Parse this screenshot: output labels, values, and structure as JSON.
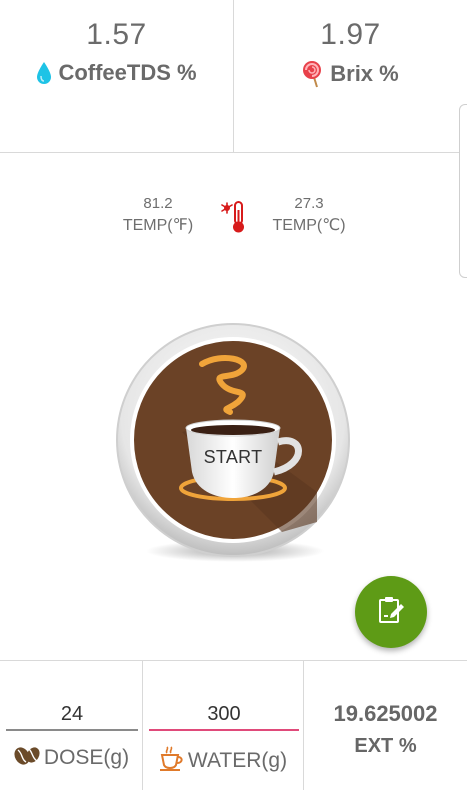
{
  "metrics": {
    "coffee_tds": {
      "value": "1.57",
      "label": "CoffeeTDS %",
      "icon": "water-drop-icon",
      "color": "#1ec3e6"
    },
    "brix": {
      "value": "1.97",
      "label": "Brix %",
      "icon": "lollipop-icon",
      "color": "#e8414a"
    }
  },
  "temperature": {
    "fahrenheit": {
      "value": "81.2",
      "label": "TEMP(℉)"
    },
    "celsius": {
      "value": "27.3",
      "label": "TEMP(℃)"
    },
    "icon": "thermometer-icon",
    "icon_color": "#d71b1b"
  },
  "start_button": {
    "label": "START",
    "steam_color": "#f0a43a",
    "cup_bg": "#6b4226"
  },
  "fab": {
    "icon": "clipboard-edit-icon",
    "color": "#5e9b16"
  },
  "inputs": {
    "dose": {
      "value": "24",
      "label": "DOSE(g)",
      "icon": "coffee-beans-icon"
    },
    "water": {
      "value": "300",
      "label": "WATER(g)",
      "icon": "coffee-cup-icon",
      "accent": "#e04a7a"
    }
  },
  "extraction": {
    "value": "19.625002",
    "label": "EXT %"
  }
}
